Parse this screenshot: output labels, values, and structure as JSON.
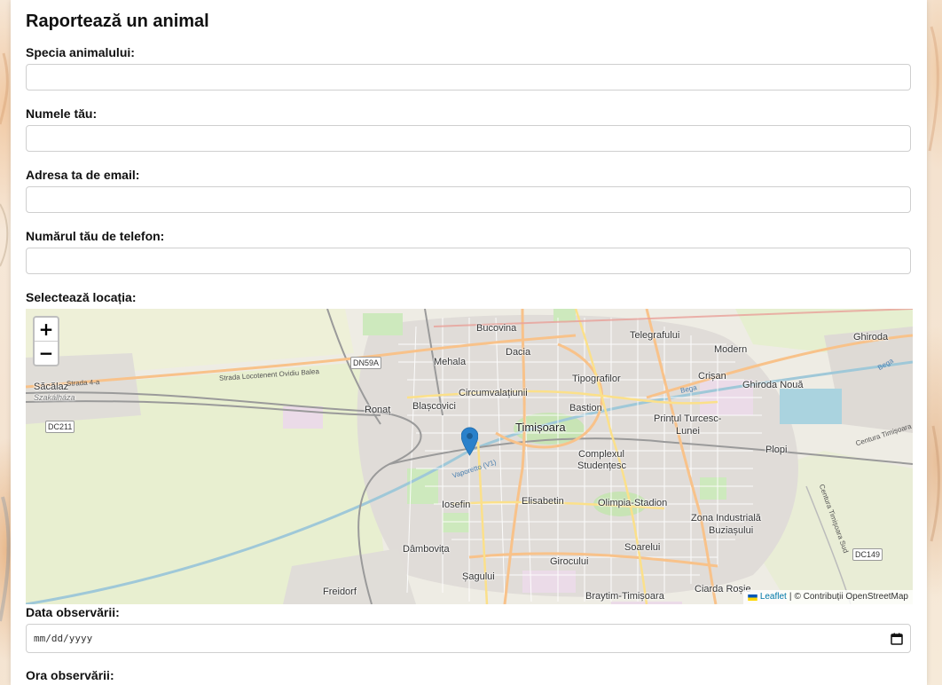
{
  "form": {
    "title": "Raportează un animal",
    "species_label": "Specia animalului:",
    "species_value": "",
    "name_label": "Numele tău:",
    "name_value": "",
    "email_label": "Adresa ta de email:",
    "email_value": "",
    "phone_label": "Numărul tău de telefon:",
    "phone_value": "",
    "location_label": "Selectează locația:",
    "date_label": "Data observării:",
    "date_placeholder": "mm/dd/yyyy",
    "time_label": "Ora observării:"
  },
  "map": {
    "zoom_in": "+",
    "zoom_out": "−",
    "attribution_link": "Leaflet",
    "attribution_separator": "|",
    "attribution_text": "© Contribuții OpenStreetMap",
    "marker_color": "#2a81cb",
    "places": {
      "bucovina": "Bucovina",
      "telegrafului": "Telegrafului",
      "ghiroda": "Ghiroda",
      "dacia": "Dacia",
      "modern": "Modern",
      "mehala": "Mehala",
      "sacalaz": "Săcălaz",
      "sacalaz_hu": "Szakálháza",
      "tipografilor": "Tipografilor",
      "crisan_n": "Crișan",
      "ghiroda_noua": "Ghiroda Nouă",
      "circumvalatiunii": "Circumvalațiunii",
      "ronat": "Ronaț",
      "blascovici": "Blașcovici",
      "bastion": "Bastion",
      "printul": "Prințul Turcesc-",
      "lunei": "Lunei",
      "timisoara": "Timișoara",
      "complex": "Complexul",
      "studentesc": "Studențesc",
      "plopi": "Plopi",
      "iosefin": "Iosefin",
      "elisabetin": "Elisabetin",
      "olimpia": "Olimpia-Stadion",
      "zona_ind": "Zona Industrială",
      "buziasului": "Buziașului",
      "dambovita": "Dâmbovița",
      "soarelui": "Soarelui",
      "girocului": "Girocului",
      "sagului": "Șagului",
      "freidorf": "Freidorf",
      "ciarda": "Ciarda Roșie",
      "braytim": "Braytim-Timișoara",
      "dn59a": "DN59A",
      "dc211": "DC211",
      "dc149": "DC149",
      "strada_44": "Strada 4-a",
      "strada_loc": "Strada Locotenent Ovidiu Balea",
      "bega": "Bega",
      "bega2": "Bega",
      "vapoare": "Vaporetto (V1)",
      "centura": "Centura Timișoara Sud",
      "centura2": "Centura Timișoara Sud"
    }
  }
}
